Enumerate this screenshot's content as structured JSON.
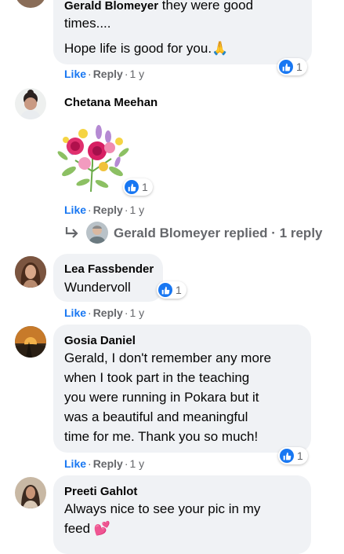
{
  "comment1": {
    "author": "Gerald Blomeyer",
    "text_after_name": " they were good",
    "line2": "times....",
    "line3": "Hope life is good for you.",
    "emoji": "🙏",
    "reaction_count": "1",
    "like": "Like",
    "reply": "Reply",
    "age": "1 y"
  },
  "comment2": {
    "author": "Chetana Meehan",
    "reaction_count": "1",
    "like": "Like",
    "reply": "Reply",
    "age": "1 y",
    "replies_summary": {
      "name": "Gerald Blomeyer",
      "action": "replied",
      "count": "1 reply"
    }
  },
  "comment3": {
    "author": "Lea Fassbender",
    "text": "Wundervoll",
    "reaction_count": "1",
    "like": "Like",
    "reply": "Reply",
    "age": "1 y"
  },
  "comment4": {
    "author": "Gosia Daniel",
    "lines": [
      "Gerald, I don't remember any more",
      "when I took part in the teaching",
      "you were running in Pokara but it",
      "was a beautiful and meaningful",
      "time for me. Thank you so much!"
    ],
    "reaction_count": "1",
    "like": "Like",
    "reply": "Reply",
    "age": "1 y"
  },
  "comment5": {
    "author": "Preeti Gahlot",
    "lines": [
      "Always nice to see your pic in my",
      "feed"
    ],
    "emoji": "💕"
  },
  "separator": "·",
  "colors": {
    "link_blue": "#1877f2",
    "bubble": "#f0f2f5",
    "meta_gray": "#65676b"
  }
}
